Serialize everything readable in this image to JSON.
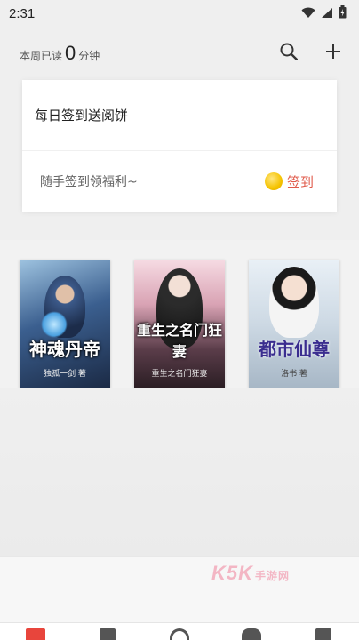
{
  "status": {
    "time": "2:31"
  },
  "header": {
    "weekly_prefix": "本周已读",
    "weekly_minutes": "0",
    "weekly_suffix": "分钟",
    "search_icon": "search-icon",
    "add_icon": "plus-icon"
  },
  "signin_card": {
    "title": "每日签到送阅饼",
    "subtitle": "随手签到领福利~",
    "button_label": "签到"
  },
  "books": [
    {
      "title": "神魂丹帝",
      "author": "独孤一剑 著"
    },
    {
      "title": "重生之名门狂妻",
      "author": "重生之名门狂妻"
    },
    {
      "title": "都市仙尊",
      "author": "洛书 著"
    }
  ],
  "watermark": {
    "brand": "K5K",
    "suffix": "手游网"
  },
  "tabs": [
    {
      "name": "bookshelf",
      "color": "#e8453c"
    },
    {
      "name": "library",
      "color": "#555555"
    },
    {
      "name": "discover",
      "color": "#555555"
    },
    {
      "name": "community",
      "color": "#555555"
    },
    {
      "name": "profile",
      "color": "#555555"
    }
  ],
  "colors": {
    "accent": "#e05a4a",
    "coin": "#f5c300"
  }
}
